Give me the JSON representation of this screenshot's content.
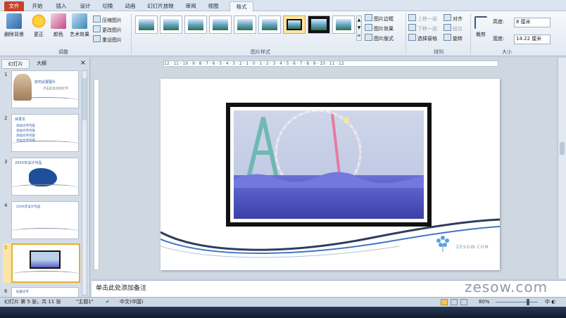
{
  "tabs": [
    "文件",
    "开始",
    "插入",
    "设计",
    "切换",
    "动画",
    "幻灯片放映",
    "审阅",
    "视图",
    "格式"
  ],
  "ribbon": {
    "adjust": {
      "remove_bg": "删除背景",
      "corrections": "更正",
      "color": "颜色",
      "artistic": "艺术效果",
      "compress": "压缩图片",
      "change": "更改图片",
      "reset": "重设图片",
      "label": "调整"
    },
    "styles": {
      "label": "图片样式",
      "border": "图片边框",
      "effects": "图片效果",
      "layout": "图片版式"
    },
    "arrange": {
      "forward": "上移一层",
      "backward": "下移一层",
      "selection_pane": "选择窗格",
      "align": "对齐",
      "group": "组合",
      "rotate": "旋转",
      "label": "排列"
    },
    "size": {
      "crop": "裁剪",
      "height_label": "高度:",
      "height_value": "8 厘米",
      "width_label": "宽度:",
      "width_value": "14.22 厘米",
      "label": "大小"
    }
  },
  "left_pane": {
    "tab_slides": "幻灯片",
    "tab_outline": "大纲",
    "close": "×",
    "slides": [
      {
        "num": "1",
        "title": "如何设置图片",
        "sub": "点击此处添加文字"
      },
      {
        "num": "2",
        "title": "目录页",
        "lines": [
          "添加文字内容",
          "添加文字内容",
          "添加文字内容",
          "添加文字内容"
        ]
      },
      {
        "num": "3",
        "title": "20XX年设计作品"
      },
      {
        "num": "4",
        "title": "20XX年设计作品"
      },
      {
        "num": "5",
        "title": ""
      },
      {
        "num": "6",
        "title": "标题文字"
      }
    ]
  },
  "ruler_text": "12 · 11 · 10 · 9 · 8 · 7 · 6 · 5 · 4 · 3 · 2 · 1 · 0 · 1 · 2 · 3 · 4 · 5 · 6 · 7 · 8 · 9 · 10 · 11 · 12",
  "slide": {
    "logo_text": "ZESOW.COM"
  },
  "notes_placeholder": "单击此处添加备注",
  "watermark": "zesow.com",
  "status": {
    "slide_info": "幻灯片 第 5 张，共 11 张",
    "theme": "\"主题1\"",
    "language": "中文(中国)",
    "zoom": "80%"
  },
  "colors": {
    "file_tab": "#c8402a",
    "ribbon_bg": "#e8eef5",
    "selected_thumb": "#e6b02f"
  }
}
